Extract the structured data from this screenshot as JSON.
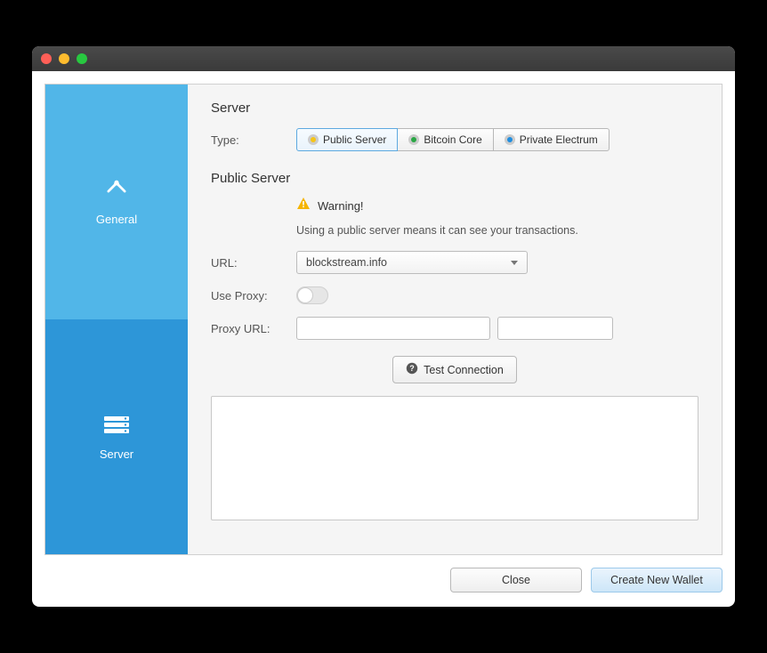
{
  "sidebar": {
    "general": {
      "label": "General"
    },
    "server": {
      "label": "Server"
    }
  },
  "server": {
    "section_title": "Server",
    "type_label": "Type:",
    "types": {
      "public": "Public Server",
      "core": "Bitcoin Core",
      "electrum": "Private Electrum"
    },
    "public": {
      "title": "Public Server",
      "warning_label": "Warning!",
      "warning_desc": "Using a public server means it can see your transactions.",
      "url_label": "URL:",
      "url_value": "blockstream.info",
      "use_proxy_label": "Use Proxy:",
      "proxy_url_label": "Proxy URL:"
    },
    "test_label": "Test Connection"
  },
  "footer": {
    "close": "Close",
    "create": "Create New Wallet"
  }
}
